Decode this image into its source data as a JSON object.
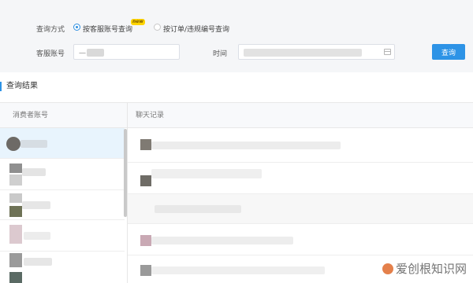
{
  "filter": {
    "query_mode_label": "查询方式",
    "option_by_account": "按客服账号查询",
    "option_by_order": "按订单/违规编号查询",
    "new_badge": "new",
    "account_label": "客服账号",
    "account_value_initial": "一",
    "time_label": "时间",
    "query_button": "查询"
  },
  "results": {
    "title": "查询结果",
    "columns": [
      "消费者账号",
      "聊天记录"
    ]
  },
  "colors": {
    "accent": "#2d93e6",
    "panel_bg": "#f5f6f8",
    "selected_row": "#e8f4fd"
  },
  "watermark": "爱创根知识网"
}
